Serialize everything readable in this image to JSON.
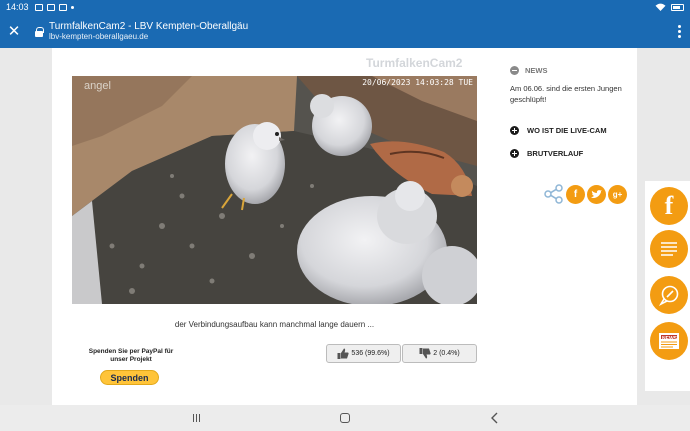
{
  "status_bar": {
    "time": "14:03"
  },
  "toolbar": {
    "title": "TurmfalkenCam2 - LBV Kempten-Oberallgäu",
    "url": "lbv-kempten-oberallgaeu.de",
    "close_glyph": "✕"
  },
  "camera": {
    "title": "TurmfalkenCam2",
    "overlay_brand": "angel",
    "timestamp": "20/06/2023 14:03:28 TUE"
  },
  "status_text": "der Verbindungsaufbau kann manchmal lange dauern ...",
  "donation": {
    "label": "Spenden Sie per PayPal für unser Projekt",
    "button_label": "Spenden"
  },
  "votes": {
    "up": "536 (99.6%)",
    "down": "2 (0.4%)"
  },
  "sidebar": {
    "news_heading": "NEWS",
    "news_text": "Am 06.06. sind die ersten Jungen geschlüpft!",
    "links": [
      "WO IST DIE LIVE-CAM",
      "BRUTVERLAUF"
    ]
  },
  "share": {
    "icons": [
      "share-icon",
      "facebook-icon",
      "twitter-icon",
      "google-plus-icon"
    ],
    "accent": "#f39c12"
  },
  "floatbar": {
    "icons": [
      "facebook-icon",
      "document-icon",
      "chat-icon",
      "newspaper-icon"
    ],
    "news_badge": "NEWS",
    "fb_glyph": "f",
    "accent": "#f39c12"
  },
  "colors": {
    "brand_blue": "#1a6ab3",
    "accent_orange": "#f39c12",
    "paypal_yellow": "#ffc439"
  }
}
